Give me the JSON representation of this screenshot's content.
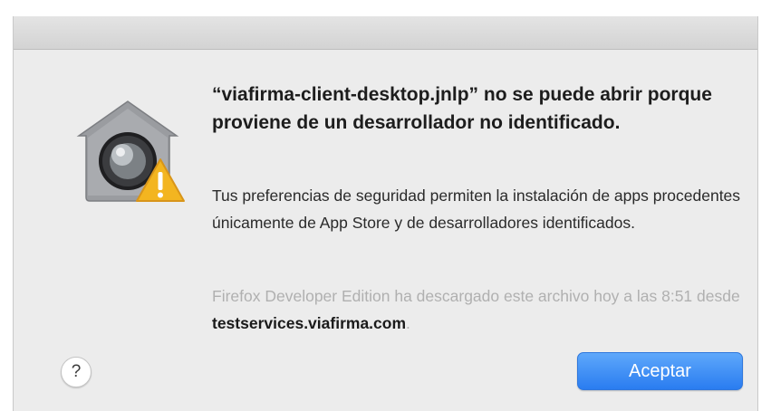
{
  "dialog": {
    "icon": "gatekeeper-security-warning-icon",
    "title": "“viafirma-client-desktop.jnlp” no se puede abrir porque proviene de un desarrollador no identificado.",
    "message": "Tus preferencias de seguridad permiten la instalación de apps procedentes únicamente de App Store y de desarrolladores identificados.",
    "source_prefix": "Firefox Developer Edition ha descargado este archivo hoy a las 8:51 desde ",
    "source_domain": "testservices.viafirma.com",
    "source_suffix": ".",
    "help_label": "?",
    "ok_label": "Aceptar"
  },
  "colors": {
    "accent": "#2a7cf0",
    "warning": "#f3b520",
    "background": "#ececec"
  }
}
